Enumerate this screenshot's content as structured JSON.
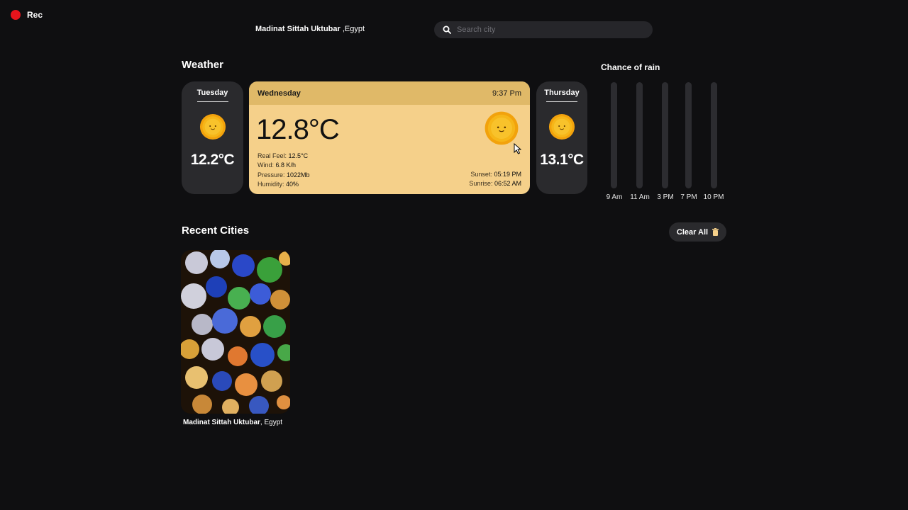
{
  "recording": {
    "label": "Rec",
    "color": "#e8141c"
  },
  "header": {
    "city": "Madinat Sittah Uktubar",
    "country": ",Egypt",
    "search_placeholder": "Search city"
  },
  "weather": {
    "title": "Weather",
    "cards": [
      {
        "day": "Tuesday",
        "temp": "12.2°C",
        "icon": "sun-icon"
      },
      {
        "day": "Thursday",
        "temp": "13.1°C",
        "icon": "sun-icon"
      }
    ],
    "current": {
      "day": "Wednesday",
      "time": "9:37 Pm",
      "temp": "12.8°C",
      "icon": "sun-icon",
      "real_feel_label": "Real Feel:",
      "real_feel": "12.5°C",
      "wind_label": "Wind:",
      "wind": "6.8 K/h",
      "pressure_label": "Pressure:",
      "pressure": "1022Mb",
      "humidity_label": "Humidity:",
      "humidity": "40%",
      "sunset_label": "Sunset:",
      "sunset": "05:19 PM",
      "sunrise_label": "Sunrise:",
      "sunrise": "06:52 AM"
    }
  },
  "rain": {
    "title": "Chance of rain",
    "hours": [
      "9 Am",
      "11 Am",
      "3 PM",
      "7 PM",
      "10 PM"
    ]
  },
  "recent": {
    "title": "Recent Cities",
    "clear_label": "Clear All",
    "cities": [
      {
        "city": "Madinat Sittah Uktubar",
        "country": ", Egypt"
      }
    ]
  },
  "colors": {
    "background": "#0f0f11",
    "card": "#2a2a2d",
    "accent": "#f5d08a",
    "accent_dark": "#e0b968"
  }
}
